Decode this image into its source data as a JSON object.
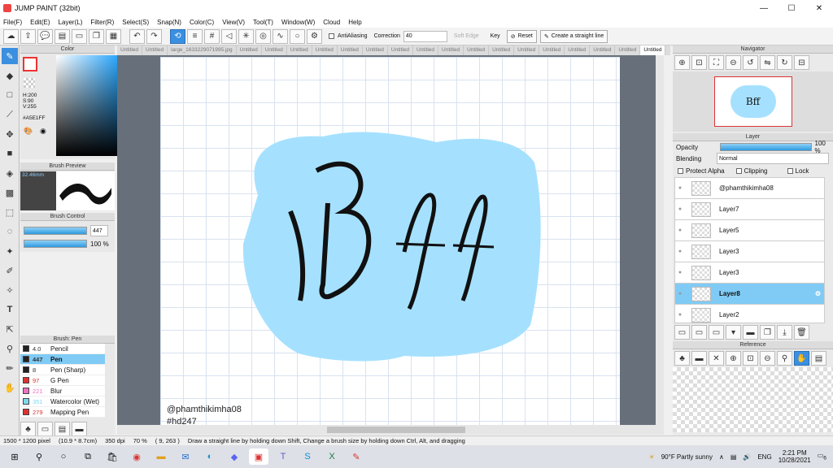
{
  "app": {
    "title": "JUMP PAINT (32bit)"
  },
  "window": {
    "min": "—",
    "max": "☐",
    "close": "✕"
  },
  "menu": [
    "File(F)",
    "Edit(E)",
    "Layer(L)",
    "Filter(R)",
    "Select(S)",
    "Snap(N)",
    "Color(C)",
    "View(V)",
    "Tool(T)",
    "Window(W)",
    "Cloud",
    "Help"
  ],
  "toolbar": {
    "antialias_label": "AntiAliasing",
    "correction_label": "Correction",
    "correction_value": "40",
    "soft_edge_label": "Soft Edge",
    "key_label": "Key",
    "reset_label": "Reset",
    "straight_line_label": "Create a straight line"
  },
  "color_panel": {
    "title": "Color",
    "h": "H:200",
    "s": "S:90",
    "v": "V:255",
    "hex": "#A5E1FF"
  },
  "brush_preview": {
    "title": "Brush Preview",
    "size": "32.46mm"
  },
  "brush_control": {
    "title": "Brush Control",
    "size_value": "447",
    "opacity_value": "100 %"
  },
  "brush_list": {
    "title": "Brush: Pen",
    "items": [
      {
        "num": "4.0",
        "name": "Pencil",
        "color": "#222222"
      },
      {
        "num": "447",
        "name": "Pen",
        "color": "#222222",
        "selected": true
      },
      {
        "num": "8",
        "name": "Pen (Sharp)",
        "color": "#222222"
      },
      {
        "num": "97",
        "name": "G Pen",
        "color": "#e03030"
      },
      {
        "num": "221",
        "name": "Blur",
        "color": "#f070c0"
      },
      {
        "num": "351",
        "name": "Watercolor (Wet)",
        "color": "#7fd8f0"
      },
      {
        "num": "279",
        "name": "Mapping Pen",
        "color": "#e03030"
      }
    ]
  },
  "tabs": [
    "Untitled",
    "Untitled",
    "large_1633229071995.jpg",
    "Untitled",
    "Untitled",
    "Untitled",
    "Untitled",
    "Untitled",
    "Untitled",
    "Untitled",
    "Untitled",
    "Untitled",
    "Untitled",
    "Untitled",
    "Untitled",
    "Untitled",
    "Untitled",
    "Untitled",
    "Untitled",
    "Untitled"
  ],
  "canvas": {
    "text": "Bff",
    "watermark1": "@phamthikimha08",
    "watermark2": "#hd247"
  },
  "navigator": {
    "title": "Navigator"
  },
  "layer_panel": {
    "title": "Layer",
    "opacity_label": "Opacity",
    "opacity_value": "100 %",
    "blending_label": "Blending",
    "blending_value": "Normal",
    "protect_alpha": "Protect Alpha",
    "clipping": "Clipping",
    "lock": "Lock",
    "layers": [
      {
        "name": "@phamthikimha08"
      },
      {
        "name": "Layer7"
      },
      {
        "name": "Layer5"
      },
      {
        "name": "Layer3"
      },
      {
        "name": "Layer3"
      },
      {
        "name": "Layer8",
        "selected": true
      },
      {
        "name": "Layer2"
      }
    ]
  },
  "reference": {
    "title": "Reference"
  },
  "status": {
    "size": "1500 * 1200 pixel",
    "cm": "(10.9 * 8.7cm)",
    "dpi": "350 dpi",
    "zoom": "70 %",
    "coords": "( 9, 263 )",
    "hint": "Draw a straight line by holding down Shift, Change a brush size by holding down Ctrl, Alt, and dragging"
  },
  "taskbar": {
    "weather": "90°F  Partly sunny",
    "lang": "ENG",
    "time": "2:21 PM",
    "date": "10/28/2021",
    "badge": "6"
  },
  "colors": {
    "accent": "#3a8fe0",
    "selection": "#7fcbf5",
    "blob": "#a5e1ff"
  }
}
